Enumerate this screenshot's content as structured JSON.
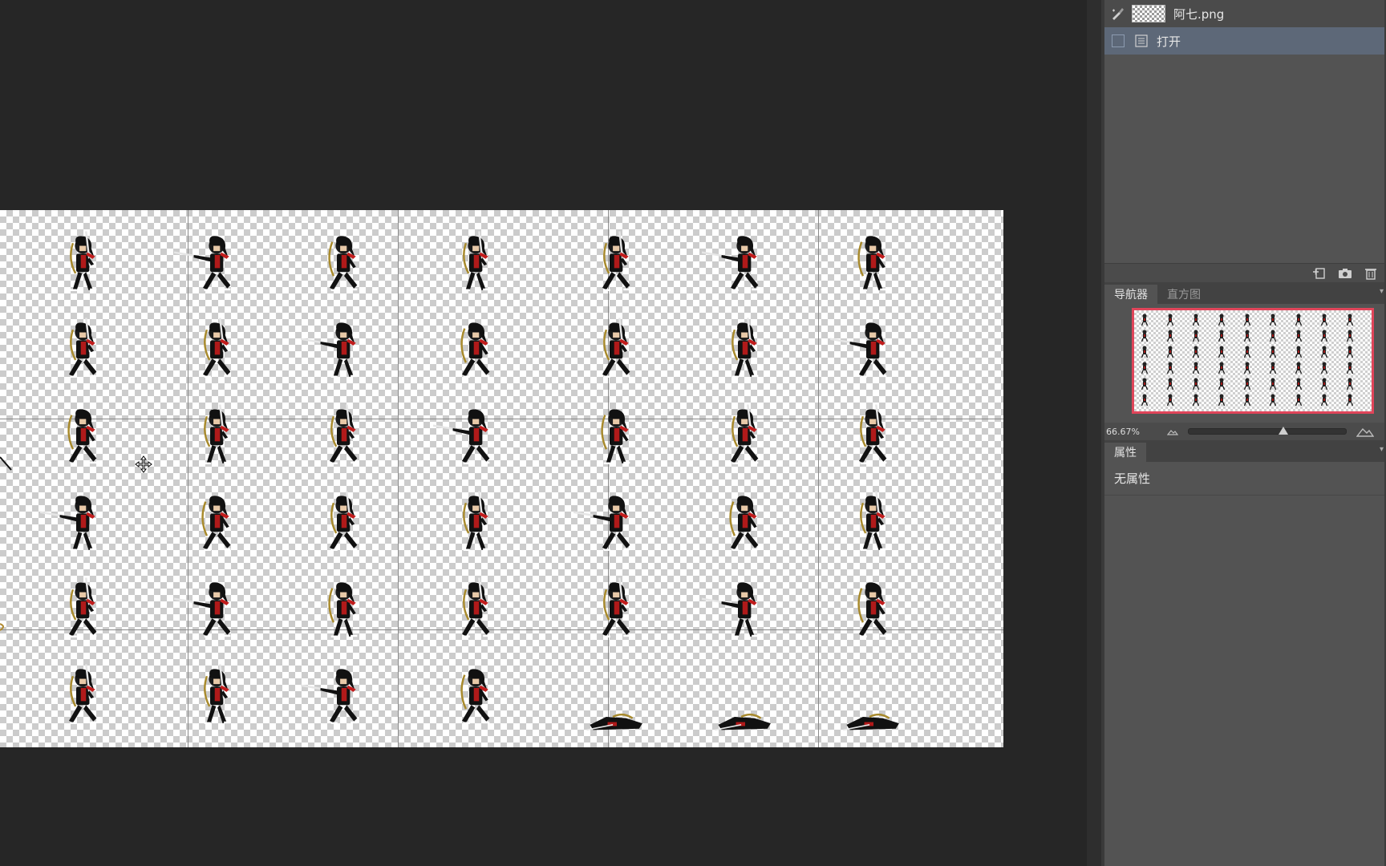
{
  "history": {
    "snapshot_label": "阿七.png",
    "steps": [
      {
        "label": "打开"
      }
    ]
  },
  "navigator": {
    "tabs": [
      {
        "label": "导航器",
        "active": true
      },
      {
        "label": "直方图",
        "active": false
      }
    ],
    "zoom": "66.67%",
    "zoom_level": 0.6
  },
  "properties": {
    "tab_label": "属性",
    "info": "无属性"
  },
  "colors": {
    "workspace": "#262626",
    "panel": "#535353",
    "selected_row": "#5d6878",
    "navigator_frame": "#e0455a"
  },
  "icons": {
    "history_brush": "history-brush-icon",
    "snapshot_doc": "document-icon",
    "new_doc": "new-document-icon",
    "camera": "camera-icon",
    "delete": "trash-icon",
    "zoom_out": "mountain-small-icon",
    "zoom_in": "mountain-large-icon"
  }
}
